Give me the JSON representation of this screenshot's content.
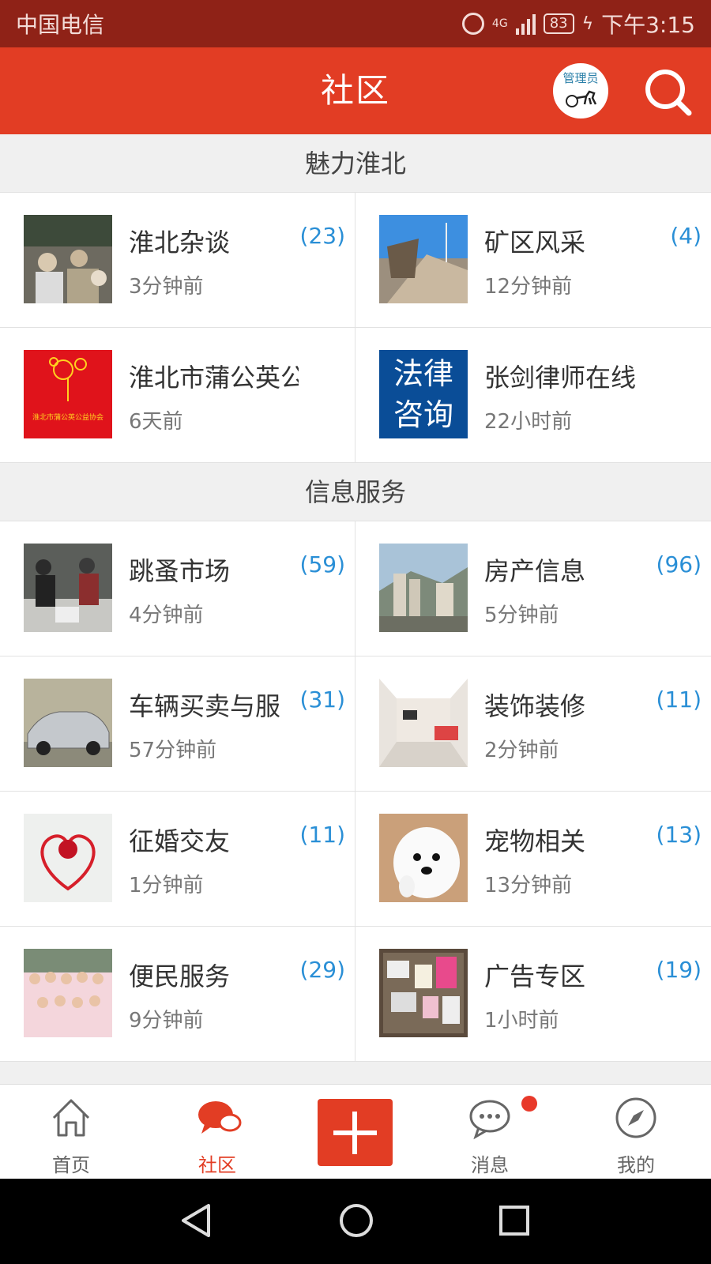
{
  "status_bar": {
    "carrier": "中国电信",
    "network": "4G",
    "battery": "83",
    "time": "下午3:15"
  },
  "header": {
    "title": "社区",
    "admin_badge_text": "管理员",
    "search_icon": "search-icon"
  },
  "sections": [
    {
      "title": "魅力淮北",
      "items": [
        {
          "name": "淮北杂谈",
          "time": "3分钟前",
          "count": "(23)"
        },
        {
          "name": "矿区风采",
          "time": "12分钟前",
          "count": "(4)"
        },
        {
          "name": "淮北市蒲公英公",
          "time": "6天前",
          "count": ""
        },
        {
          "name": "张剑律师在线",
          "time": "22小时前",
          "count": ""
        }
      ]
    },
    {
      "title": "信息服务",
      "items": [
        {
          "name": "跳蚤市场",
          "time": "4分钟前",
          "count": "(59)"
        },
        {
          "name": "房产信息",
          "time": "5分钟前",
          "count": "(96)"
        },
        {
          "name": "车辆买卖与服",
          "time": "57分钟前",
          "count": "(31)"
        },
        {
          "name": "装饰装修",
          "time": "2分钟前",
          "count": "(11)"
        },
        {
          "name": "征婚交友",
          "time": "1分钟前",
          "count": "(11)"
        },
        {
          "name": "宠物相关",
          "time": "13分钟前",
          "count": "(13)"
        },
        {
          "name": "便民服务",
          "time": "9分钟前",
          "count": "(29)"
        },
        {
          "name": "广告专区",
          "time": "1小时前",
          "count": "(19)"
        }
      ]
    }
  ],
  "thumb_texts": {
    "dandelion_org": "淮北市蒲公英公益协会",
    "law_line1": "法律",
    "law_line2": "咨询"
  },
  "tabbar": {
    "tabs": [
      {
        "label": "首页",
        "icon": "home-icon"
      },
      {
        "label": "社区",
        "icon": "community-icon"
      },
      {
        "label": "",
        "icon": "plus-icon"
      },
      {
        "label": "消息",
        "icon": "message-icon"
      },
      {
        "label": "我的",
        "icon": "compass-icon"
      }
    ]
  },
  "colors": {
    "brand": "#e23d24",
    "status_bar": "#8f2217",
    "count": "#2a8fd6"
  }
}
